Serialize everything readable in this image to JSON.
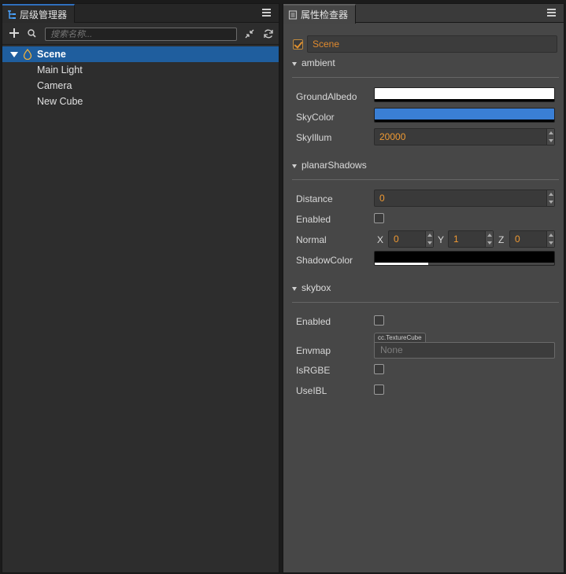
{
  "hierarchy": {
    "tab_title": "层级管理器",
    "search_placeholder": "搜索名称...",
    "tree": [
      {
        "label": "Scene",
        "selected": true
      },
      {
        "label": "Main Light"
      },
      {
        "label": "Camera"
      },
      {
        "label": "New Cube"
      }
    ]
  },
  "inspector": {
    "tab_title": "属性检查器",
    "node_name": "Scene",
    "node_enabled": true,
    "sections": {
      "ambient": {
        "title": "ambient",
        "ground_albedo_label": "GroundAlbedo",
        "ground_albedo_color": "#ffffff",
        "sky_color_label": "SkyColor",
        "sky_color": "#3a7fd5",
        "sky_illum_label": "SkyIllum",
        "sky_illum_value": "20000"
      },
      "planar_shadows": {
        "title": "planarShadows",
        "distance_label": "Distance",
        "distance_value": "0",
        "enabled_label": "Enabled",
        "enabled": false,
        "normal_label": "Normal",
        "normal_x_label": "X",
        "normal_x": "0",
        "normal_y_label": "Y",
        "normal_y": "1",
        "normal_z_label": "Z",
        "normal_z": "0",
        "shadow_color_label": "ShadowColor",
        "shadow_color": "#000000"
      },
      "skybox": {
        "title": "skybox",
        "enabled_label": "Enabled",
        "enabled": false,
        "envmap_label": "Envmap",
        "envmap_type": "cc.TextureCube",
        "envmap_value": "None",
        "is_rgbe_label": "IsRGBE",
        "is_rgbe": false,
        "use_ibl_label": "UseIBL",
        "use_ibl": false
      }
    }
  }
}
